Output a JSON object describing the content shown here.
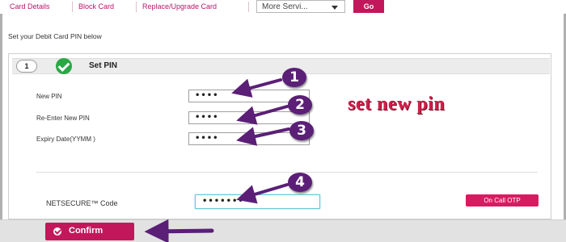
{
  "nav": {
    "tabs": [
      "Card Details",
      "Block Card",
      "Replace/Upgrade Card"
    ],
    "services_select_value": "More Servi...",
    "go_label": "Go"
  },
  "instruction": "Set your Debit Card PIN below",
  "step": {
    "number": "1",
    "title": "Set PIN"
  },
  "form": {
    "new_pin_label": "New PIN",
    "new_pin_value": "••••",
    "reenter_pin_label": "Re-Enter New PIN",
    "reenter_pin_value": "••••",
    "expiry_label": "Expiry Date(YYMM )",
    "expiry_value": "••••",
    "netsecure_label": "NETSECURE™ Code",
    "netsecure_value": "•••••••",
    "otp_button_label": "On Call OTP"
  },
  "confirm_label": "Confirm",
  "annotations": {
    "badges": [
      "1",
      "2",
      "3",
      "4"
    ],
    "caption": "set new pin",
    "color": "#5b1f77"
  },
  "colors": {
    "accent": "#c2185b",
    "success": "#2aa844",
    "annotation_text": "#d11f4a"
  }
}
